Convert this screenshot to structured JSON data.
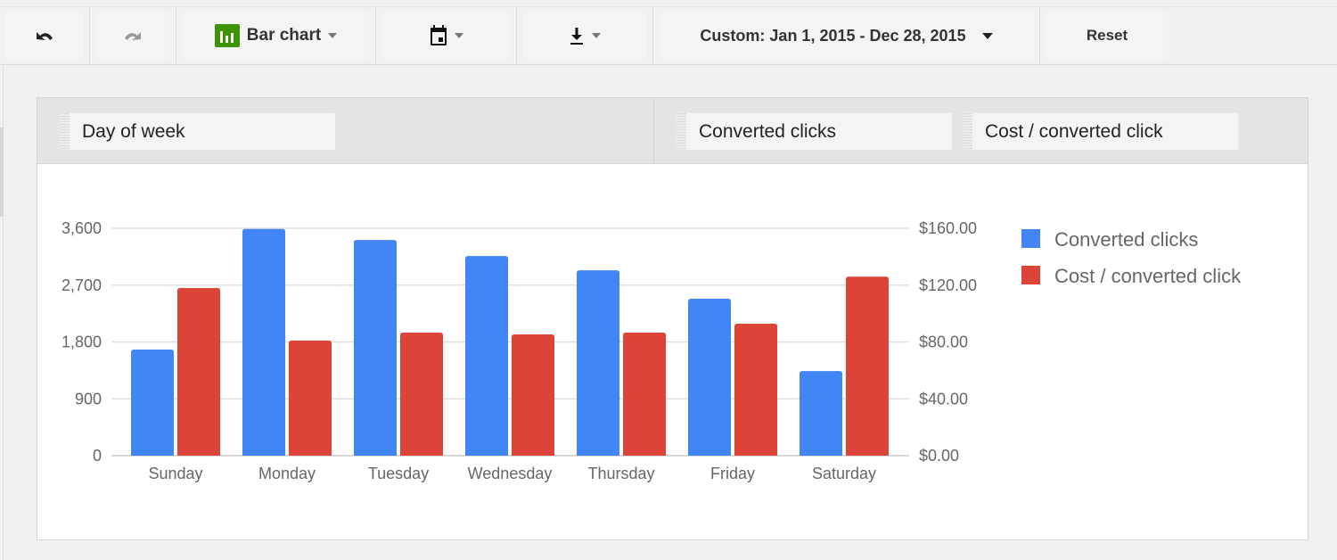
{
  "toolbar": {
    "undo_icon": "undo-icon",
    "redo_icon": "redo-icon",
    "chart_type_label": "Bar chart",
    "chart_type_icon": "bar-chart-icon",
    "calendar_icon": "calendar-icon",
    "download_icon": "download-icon",
    "date_range_label": "Custom: Jan 1, 2015 - Dec 28, 2015",
    "reset_label": "Reset"
  },
  "panel": {
    "dimension_pill": "Day of week",
    "metric_pills": [
      "Converted clicks",
      "Cost / converted click"
    ]
  },
  "colors": {
    "series1": "#4285f4",
    "series2": "#db4437",
    "chart_type_icon_bg": "#3d9400"
  },
  "chart_data": {
    "type": "bar",
    "title": "",
    "xlabel": "",
    "ylabel": "Converted clicks",
    "y2label": "Cost / converted click",
    "categories": [
      "Sunday",
      "Monday",
      "Tuesday",
      "Wednesday",
      "Thursday",
      "Friday",
      "Saturday"
    ],
    "series": [
      {
        "name": "Converted clicks",
        "axis": "left",
        "color": "#4285f4",
        "values": [
          1680,
          3590,
          3415,
          3160,
          2935,
          2485,
          1340
        ]
      },
      {
        "name": "Cost / converted click",
        "axis": "right",
        "color": "#db4437",
        "values": [
          118.0,
          81.0,
          86.6,
          85.3,
          86.6,
          92.9,
          126.0
        ]
      }
    ],
    "ylim": [
      0,
      3600
    ],
    "y2lim": [
      0,
      160
    ],
    "yticks": [
      "0",
      "900",
      "1,800",
      "2,700",
      "3,600"
    ],
    "y2ticks": [
      "$0.00",
      "$40.00",
      "$80.00",
      "$120.00",
      "$160.00"
    ],
    "grid": true,
    "legend": "right"
  }
}
